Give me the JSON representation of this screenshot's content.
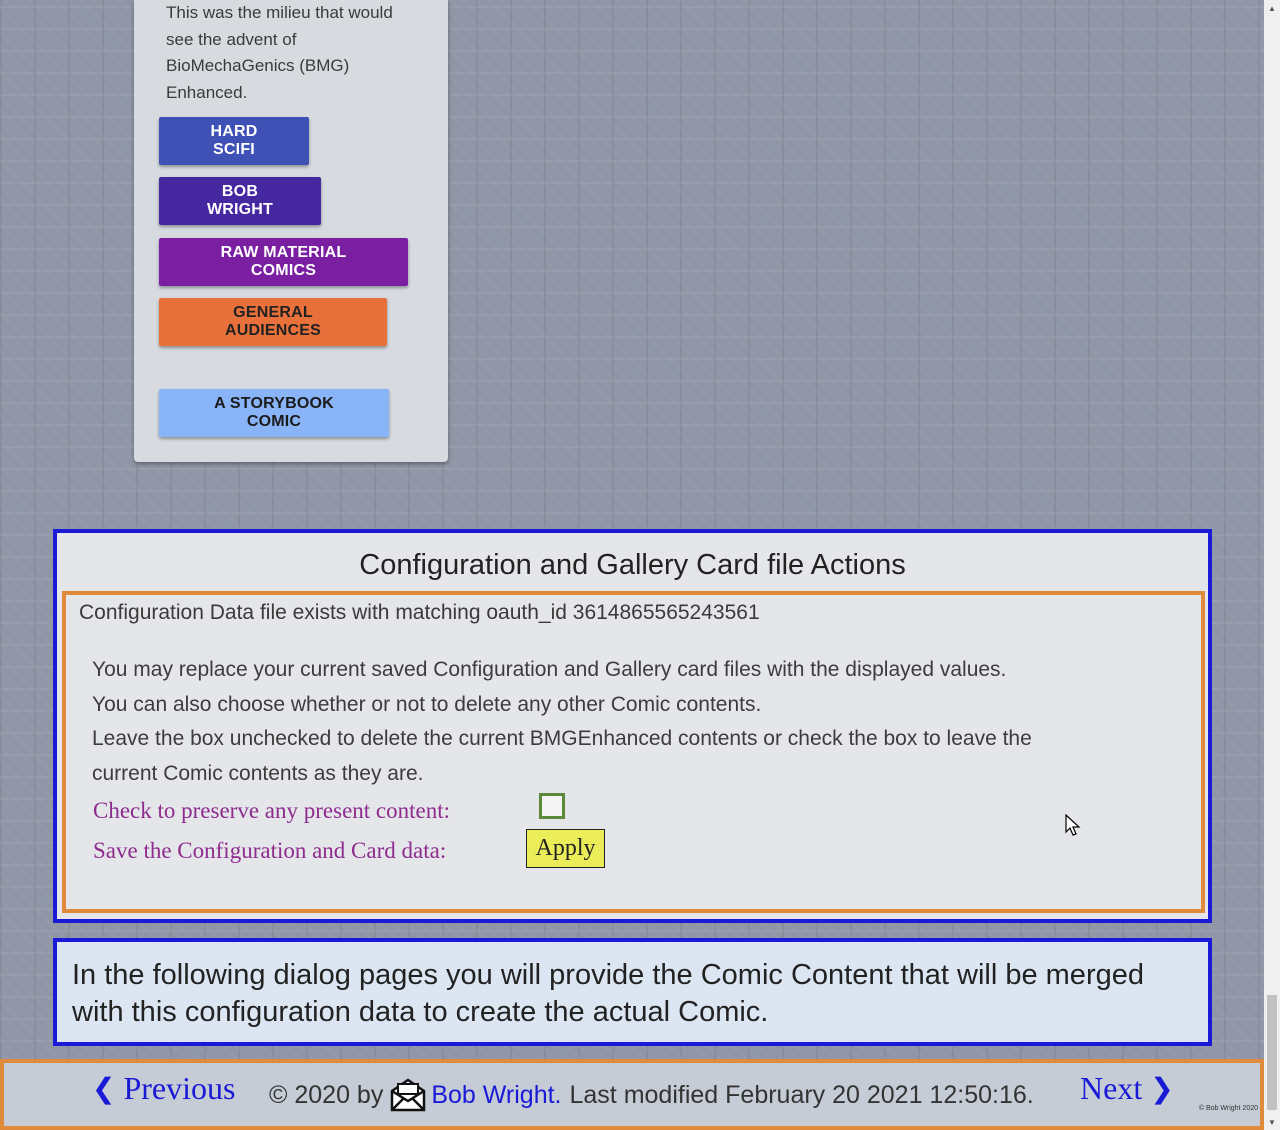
{
  "card": {
    "text_lines": [
      "This was the milieu that would",
      "see the advent of",
      "BioMechaGenics (BMG)",
      "Enhanced."
    ],
    "chips": [
      {
        "label": "HARD SCIFI",
        "color": "#3f51b5"
      },
      {
        "label": "BOB WRIGHT",
        "color": "#4527a0"
      },
      {
        "label": "RAW MATERIAL COMICS",
        "color": "#7b1fa2"
      },
      {
        "label": "GENERAL AUDIENCES",
        "color": "#e8703a"
      },
      {
        "label": "A STORYBOOK COMIC",
        "color": "#8ab4f8"
      }
    ]
  },
  "config": {
    "title": "Configuration and Gallery Card file Actions",
    "exists_line": "Configuration Data file exists with matching oauth_id 3614865565243561",
    "paragraph_lines": [
      "You may replace your current saved Configuration and Gallery card files with the displayed values.",
      "You can also choose whether or not to delete any other Comic contents.",
      "Leave the box unchecked to delete the current BMGEnhanced contents or check the box to leave the",
      "current Comic contents as they are."
    ],
    "preserve_label": "Check to preserve any present content:",
    "preserve_checked": false,
    "save_label": "Save the Configuration and Card data:",
    "apply_label": "Apply"
  },
  "info": {
    "text": "In the following dialog pages you will provide the Comic Content that will be merged with this configuration data to create the actual Comic."
  },
  "footer": {
    "previous_label": "Previous",
    "previous_icon": "chevron-left-icon",
    "copyright_prefix": "© 2020 by",
    "mail_icon": "envelope-icon",
    "author": "Bob Wright.",
    "modified": "Last modified February 20 2021 12:50:16.",
    "next_label": "Next",
    "next_icon": "chevron-right-icon",
    "tiny_copyright": "© Bob Wright 2020"
  },
  "colors": {
    "section_border": "#1a1ad6",
    "inner_border": "#e08a3c",
    "option_label": "#8e2b8e",
    "apply_bg": "#eaed58",
    "link": "#1a1ad6"
  }
}
